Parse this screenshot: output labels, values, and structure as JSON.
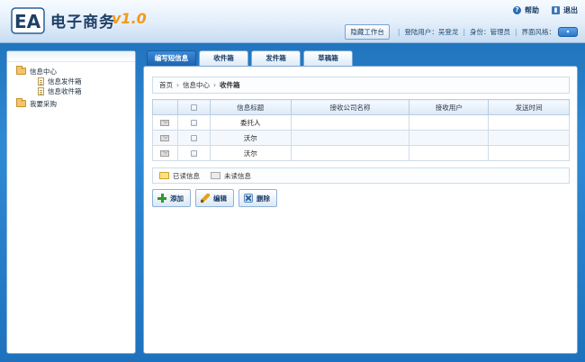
{
  "app": {
    "logo_text": "EA",
    "title": "电子商务",
    "version": "v1.0"
  },
  "top_links": {
    "help": "帮助",
    "logout": "退出"
  },
  "status": {
    "hide_workspace": "隐藏工作台",
    "login_user": "登陆用户：吴登龙",
    "role": "身份：管理员",
    "theme_label": "界面风格："
  },
  "sidebar": {
    "items": [
      {
        "label": "信息中心",
        "children": [
          {
            "label": "信息发件箱"
          },
          {
            "label": "信息收件箱"
          }
        ]
      },
      {
        "label": "我要采购"
      }
    ]
  },
  "tabs": [
    {
      "label": "编写短信息",
      "active": true
    },
    {
      "label": "收件箱"
    },
    {
      "label": "发件箱"
    },
    {
      "label": "草稿箱"
    }
  ],
  "breadcrumb": [
    "首页",
    "信息中心",
    "收件箱"
  ],
  "table": {
    "headers": [
      "",
      "",
      "信息标题",
      "接收公司名称",
      "接收用户",
      "发送时间"
    ],
    "rows": [
      {
        "title": "委托人",
        "company": "",
        "user": "",
        "time": ""
      },
      {
        "title": "沃尔",
        "company": "",
        "user": "",
        "time": ""
      },
      {
        "title": "沃尔",
        "company": "",
        "user": "",
        "time": ""
      }
    ]
  },
  "legend": {
    "read": "已读信息",
    "unread": "未读信息"
  },
  "actions": {
    "add": "添加",
    "edit": "编辑",
    "delete": "删除"
  },
  "colors": {
    "background": "#2f8ad6",
    "accent": "#1d63ad",
    "version": "#f39a1a"
  }
}
